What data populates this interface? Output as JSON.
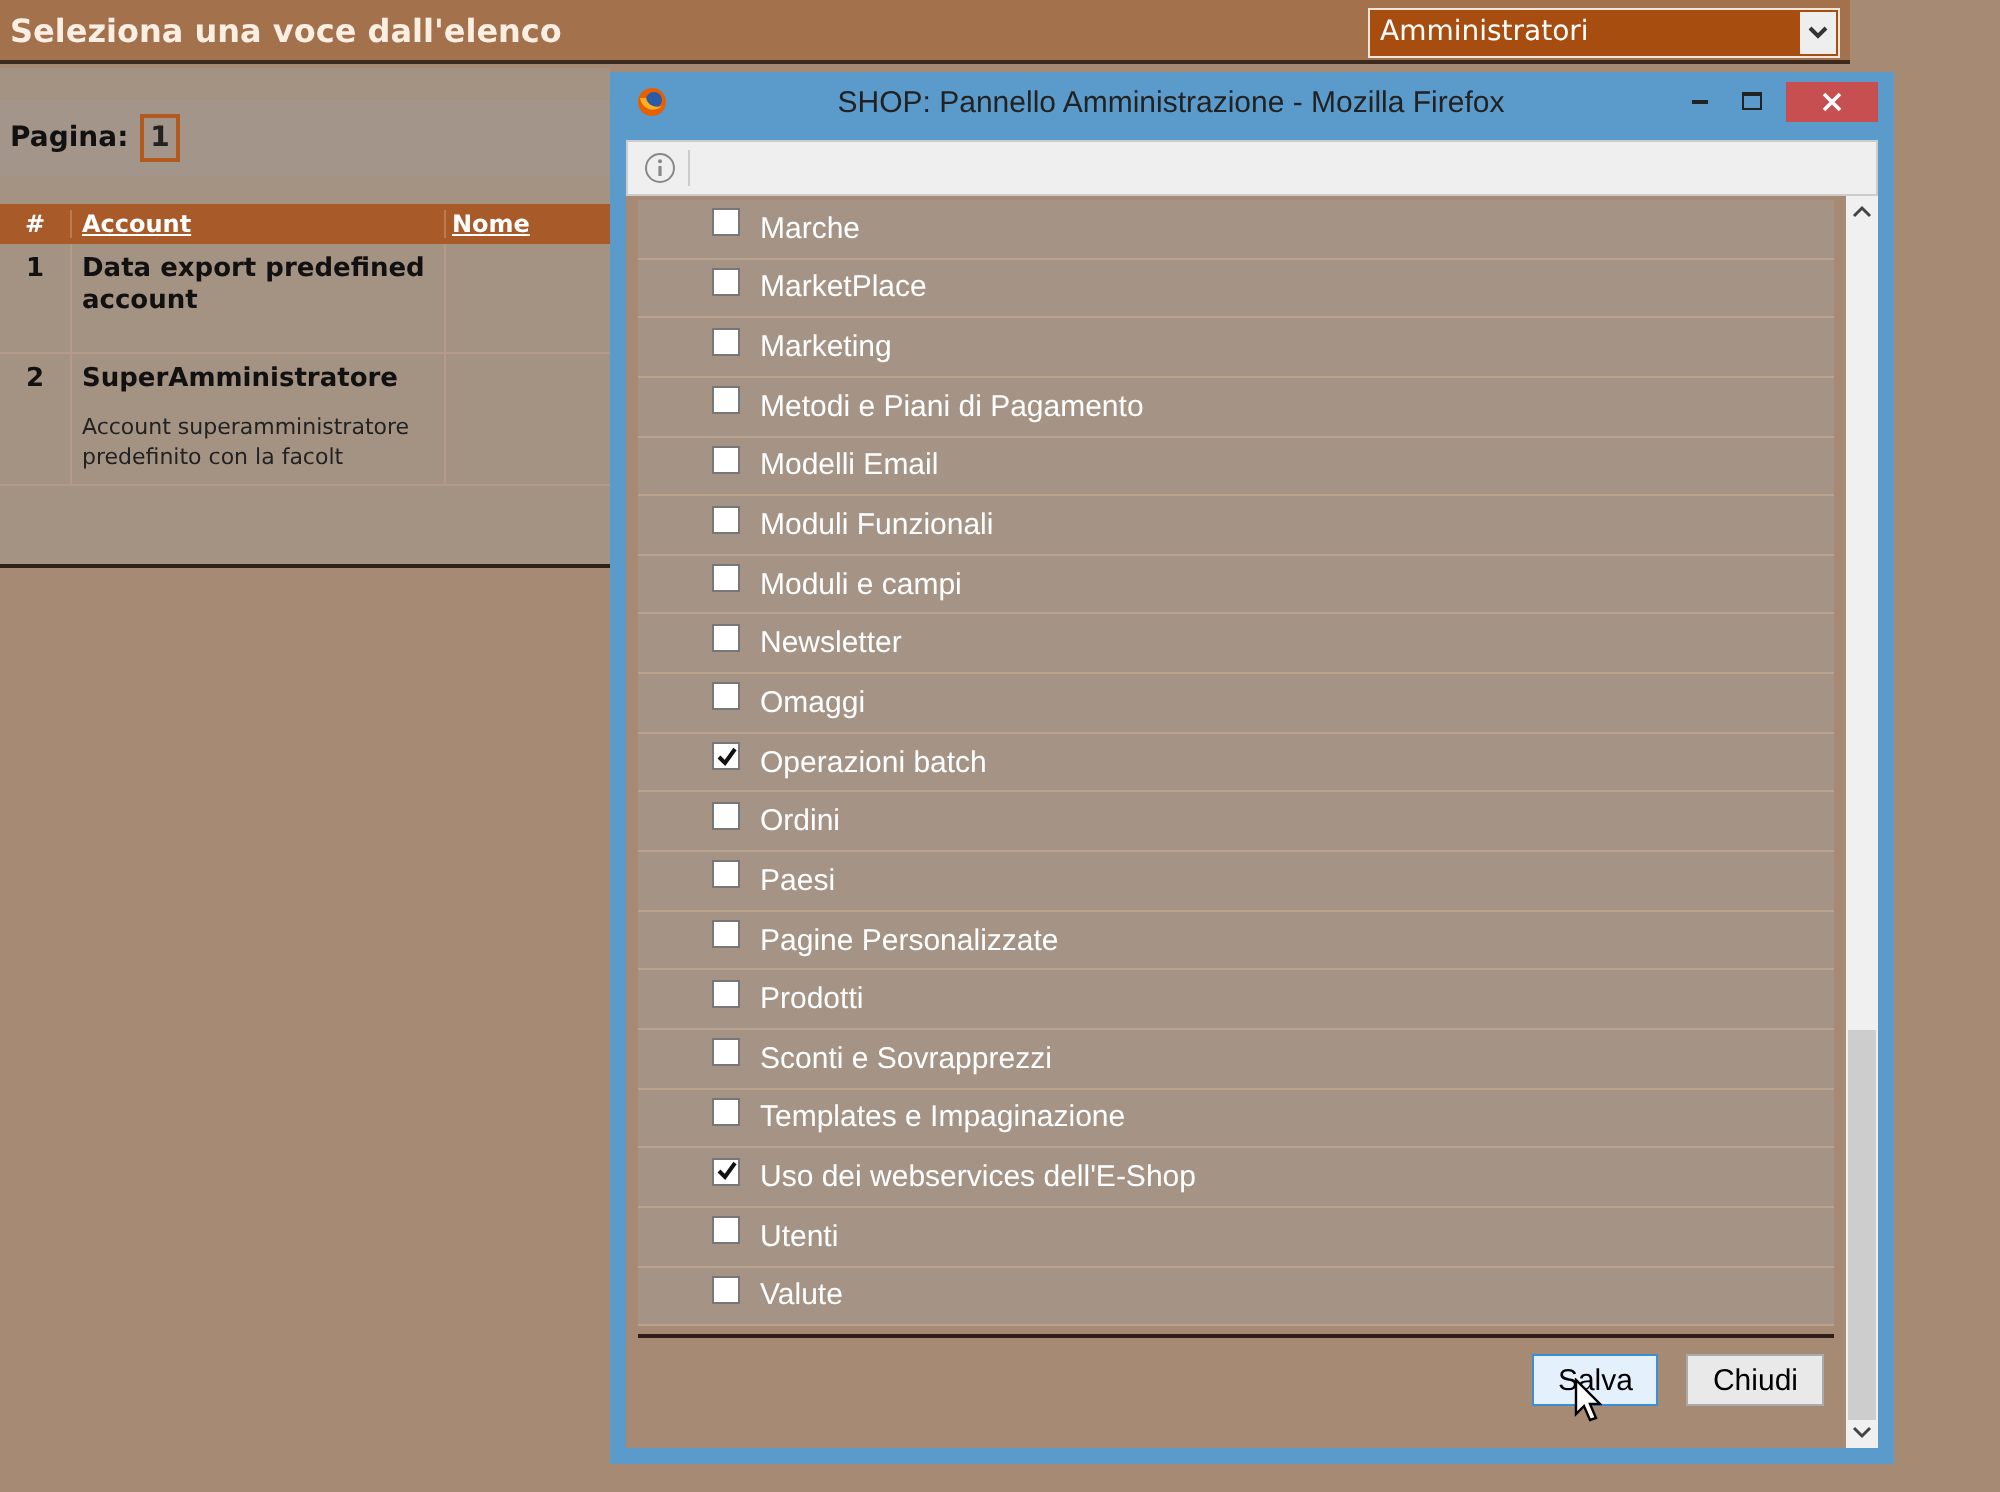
{
  "page": {
    "title": "Seleziona una voce dall'elenco",
    "group_select": {
      "value": "Amministratori"
    },
    "pager": {
      "label": "Pagina:",
      "pages": [
        {
          "label": "1",
          "selected": true
        }
      ]
    },
    "table": {
      "columns": [
        "#",
        "Account",
        "Nome"
      ],
      "rows": [
        {
          "index": "1",
          "account": "Data export predefined account",
          "description": ""
        },
        {
          "index": "2",
          "account": "SuperAmministratore",
          "description": "Account superamministratore predefinito con la facolt"
        }
      ]
    }
  },
  "popup": {
    "title": "SHOP: Pannello Amministrazione - Mozilla Firefox",
    "permissions": [
      {
        "label": "Marche",
        "checked": false
      },
      {
        "label": "MarketPlace",
        "checked": false
      },
      {
        "label": "Marketing",
        "checked": false
      },
      {
        "label": "Metodi e Piani di Pagamento",
        "checked": false
      },
      {
        "label": "Modelli Email",
        "checked": false
      },
      {
        "label": "Moduli Funzionali",
        "checked": false
      },
      {
        "label": "Moduli e campi",
        "checked": false
      },
      {
        "label": "Newsletter",
        "checked": false
      },
      {
        "label": "Omaggi",
        "checked": false
      },
      {
        "label": "Operazioni batch",
        "checked": true
      },
      {
        "label": "Ordini",
        "checked": false
      },
      {
        "label": "Paesi",
        "checked": false
      },
      {
        "label": "Pagine Personalizzate",
        "checked": false
      },
      {
        "label": "Prodotti",
        "checked": false
      },
      {
        "label": "Sconti e Sovrapprezzi",
        "checked": false
      },
      {
        "label": "Templates e Impaginazione",
        "checked": false
      },
      {
        "label": "Uso dei webservices dell'E-Shop",
        "checked": true
      },
      {
        "label": "Utenti",
        "checked": false
      },
      {
        "label": "Valute",
        "checked": false
      }
    ],
    "buttons": [
      {
        "label": "Salva",
        "kind": "primary"
      },
      {
        "label": "Chiudi",
        "kind": "normal"
      }
    ]
  }
}
